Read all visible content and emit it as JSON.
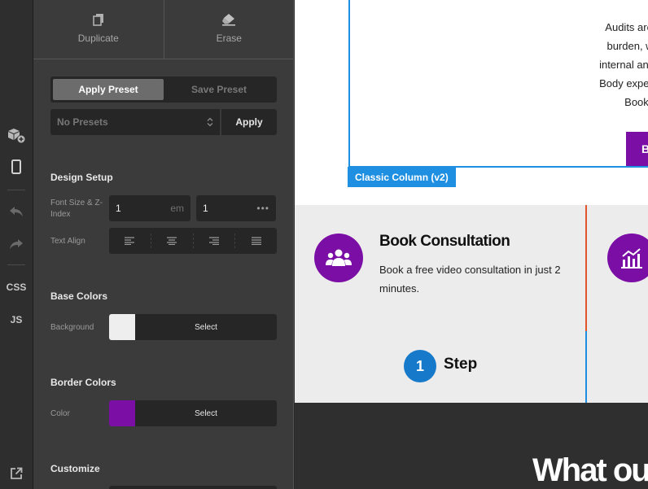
{
  "rail": {
    "items": [
      {
        "icon": "add-block-icon"
      },
      {
        "icon": "mobile-icon"
      },
      {
        "icon": "undo-icon"
      },
      {
        "icon": "redo-icon"
      }
    ],
    "css_label": "CSS",
    "js_label": "JS",
    "external_icon": "external-link-icon"
  },
  "panel": {
    "duplicate_label": "Duplicate",
    "erase_label": "Erase",
    "preset_tabs": [
      "Apply Preset",
      "Save Preset"
    ],
    "preset_select_value": "No Presets",
    "preset_apply_label": "Apply",
    "design_setup_title": "Design Setup",
    "font_size_label": "Font Size & Z-Index",
    "font_size_value": "1",
    "font_size_unit": "em",
    "z_index_value": "1",
    "z_index_more": "•••",
    "text_align_label": "Text Align",
    "base_colors_title": "Base Colors",
    "background_label": "Background",
    "background_color": "#eeeeee",
    "background_select": "Select",
    "border_colors_title": "Border Colors",
    "color_label": "Color",
    "border_color": "#7b0fa5",
    "border_select": "Select",
    "customize_title": "Customize"
  },
  "canvas": {
    "classic_lines": [
      "Audits are challengin",
      "burden, whether you",
      "internal and supplier a",
      "Body experience we h",
      "Book a video cor"
    ],
    "purple_button_text": "B",
    "column_tag": "Classic Column (v2)",
    "card_title": "Book Consultation",
    "card_desc": "Book a free video consultation in just 2 minutes.",
    "step_number": "1",
    "step_label": "Step",
    "dark_heading": "What ou",
    "colors": {
      "accent": "#7b0fa5",
      "blue": "#1e8fe1",
      "orange": "#e0552a"
    }
  }
}
